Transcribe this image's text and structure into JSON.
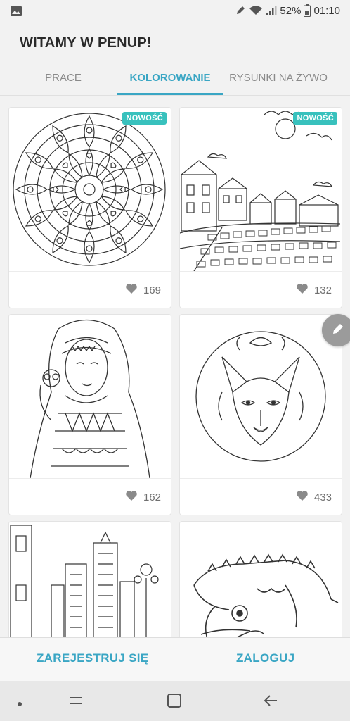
{
  "status_bar": {
    "battery": "52%",
    "time": "01:10",
    "icons": [
      "gallery-icon",
      "pen-icon",
      "wifi-icon",
      "signal-icon",
      "battery-icon"
    ]
  },
  "header": {
    "title": "WITAMY W PENUP!",
    "tabs": [
      {
        "label": "PRACE",
        "active": false
      },
      {
        "label": "KOLOROWANIE",
        "active": true
      },
      {
        "label": "RYSUNKI NA ŻYWO",
        "active": false
      }
    ]
  },
  "cards": [
    {
      "badge": "NOWOŚĆ",
      "likes": "169",
      "art": "mandala"
    },
    {
      "badge": "NOWOŚĆ",
      "likes": "132",
      "art": "village-street"
    },
    {
      "badge": "",
      "likes": "162",
      "art": "woman-with-owl"
    },
    {
      "badge": "",
      "likes": "433",
      "art": "wolf-mandala"
    },
    {
      "badge": "",
      "likes": "",
      "art": "city-street"
    },
    {
      "badge": "",
      "likes": "",
      "art": "crocodile"
    }
  ],
  "auth": {
    "register_label": "ZAREJESTRUJ SIĘ",
    "login_label": "ZALOGUJ"
  },
  "colors": {
    "accent": "#3aa6c4",
    "badge": "#38c1bd",
    "background": "#f2f2f2"
  }
}
